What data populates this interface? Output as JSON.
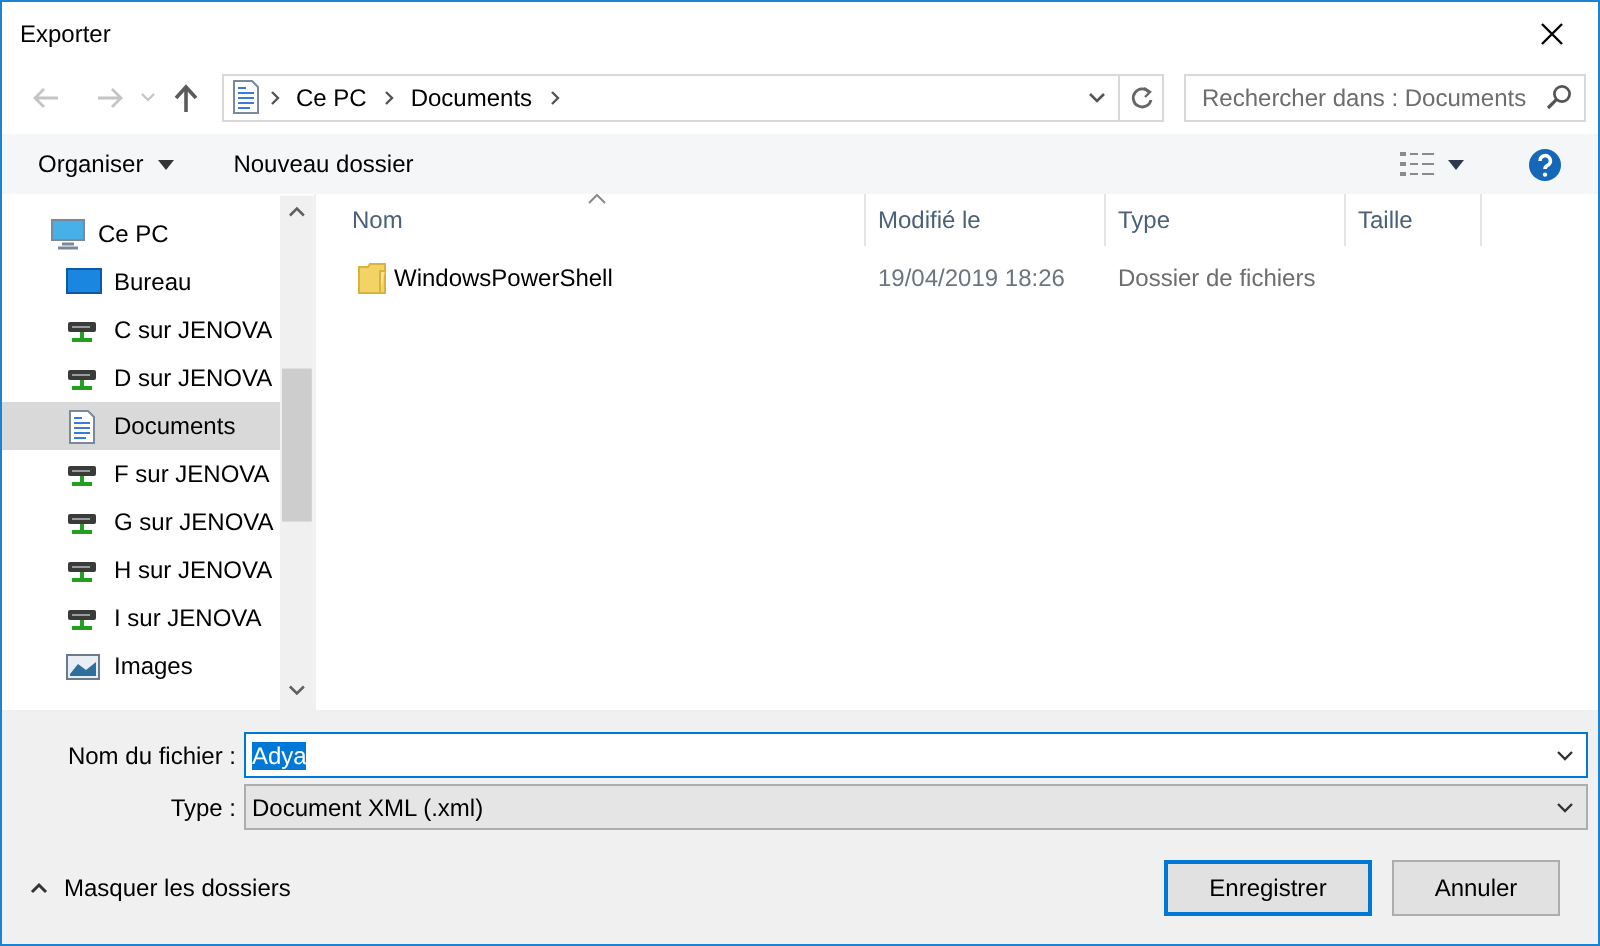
{
  "window": {
    "title": "Exporter"
  },
  "nav_buttons": [
    {
      "kind": "back",
      "disabled": true
    },
    {
      "kind": "forward",
      "disabled": true
    },
    {
      "kind": "recent",
      "disabled": true
    },
    {
      "kind": "up",
      "disabled": false
    }
  ],
  "breadcrumb": [
    "Ce PC",
    "Documents"
  ],
  "search": {
    "placeholder": "Rechercher dans : Documents"
  },
  "toolbar": {
    "organize": "Organiser",
    "new_folder": "Nouveau dossier"
  },
  "sidebar": {
    "items": [
      {
        "label": "Ce PC",
        "kind": "pc",
        "selected": false,
        "children": [
          {
            "label": "Bureau",
            "kind": "desktop",
            "selected": false
          },
          {
            "label": "C sur JENOVA",
            "kind": "drive",
            "selected": false
          },
          {
            "label": "D sur JENOVA",
            "kind": "drive",
            "selected": false
          },
          {
            "label": "Documents",
            "kind": "doc",
            "selected": true
          },
          {
            "label": "F sur JENOVA",
            "kind": "drive",
            "selected": false
          },
          {
            "label": "G sur JENOVA",
            "kind": "drive",
            "selected": false
          },
          {
            "label": "H sur JENOVA",
            "kind": "drive",
            "selected": false
          },
          {
            "label": "I sur JENOVA",
            "kind": "drive",
            "selected": false
          },
          {
            "label": "Images",
            "kind": "images",
            "selected": false
          }
        ]
      }
    ]
  },
  "columns": [
    {
      "label": "Nom",
      "sorted": true
    },
    {
      "label": "Modifié le",
      "sorted": false
    },
    {
      "label": "Type",
      "sorted": false
    },
    {
      "label": "Taille",
      "sorted": false
    }
  ],
  "files": [
    {
      "name": "WindowsPowerShell",
      "modified": "19/04/2019 18:26",
      "type": "Dossier de fichiers"
    }
  ],
  "footer": {
    "filename_label": "Nom du fichier :",
    "filename": "Adya",
    "filename_selected": true,
    "type_label": "Type :",
    "type_value": "Document XML (.xml)",
    "hide_folders": "Masquer les dossiers",
    "buttons": [
      {
        "label": "Enregistrer",
        "default": true
      },
      {
        "label": "Annuler",
        "default": false
      }
    ]
  }
}
